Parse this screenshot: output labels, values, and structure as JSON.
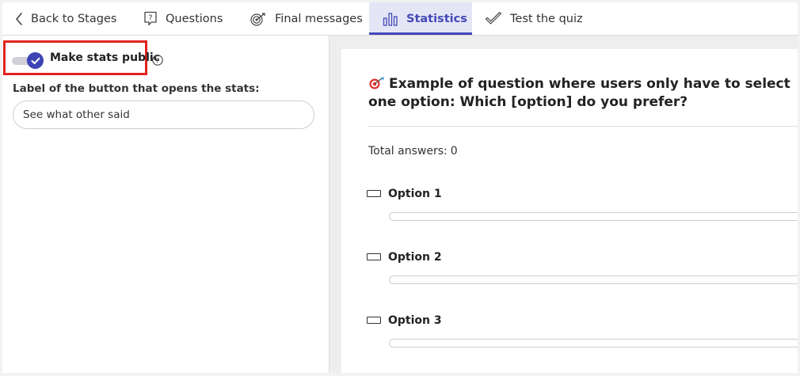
{
  "nav": {
    "back_label": "Back to Stages",
    "questions_label": "Questions",
    "final_label": "Final messages",
    "statistics_label": "Statistics",
    "test_label": "Test the quiz",
    "active_tab": "Statistics",
    "accent_color": "#4349b8"
  },
  "settings": {
    "toggle_label": "Make stats public",
    "toggle_on": true,
    "button_label_caption": "Label of the button that opens the stats:",
    "button_label_value": "See what other said"
  },
  "stats": {
    "question_title": "Example of question where users only have to select one option: Which [option] do you prefer?",
    "total_label": "Total answers:",
    "total_value": "0",
    "options": [
      {
        "label": "Option 1",
        "fraction": 0
      },
      {
        "label": "Option 2",
        "fraction": 0
      },
      {
        "label": "Option 3",
        "fraction": 0
      }
    ]
  },
  "icons": [
    "chevron-left-icon",
    "question-bubble-icon",
    "target-icon",
    "bar-chart-icon",
    "checkmark-icon",
    "help-icon",
    "check-icon",
    "dart-target-emoji",
    "option-rectangle-icon"
  ]
}
